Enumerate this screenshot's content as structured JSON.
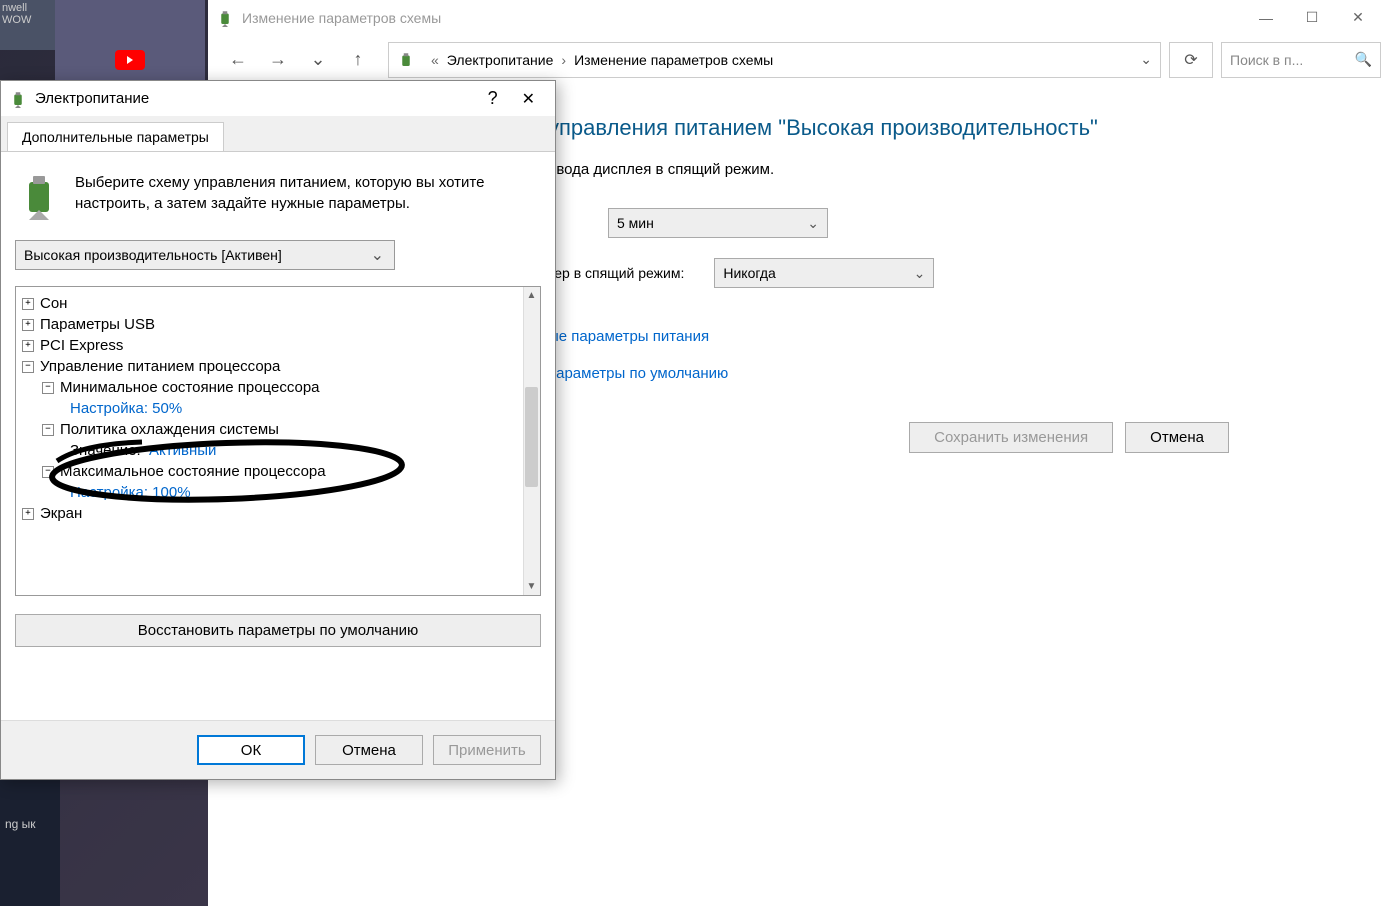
{
  "desktop": {
    "icon1": "nwell\nWOW",
    "yt_label": "YouTu",
    "bottom_label": "ng\nык"
  },
  "main_window": {
    "title": "Изменение параметров схемы",
    "breadcrumb": {
      "seg1_prefix": "«",
      "seg1": "Электропитание",
      "seg2": "Изменение параметров схемы"
    },
    "search_placeholder": "Поиск в п...",
    "heading": "управления питанием \"Высокая производительность\"",
    "subheading": "евода дисплея в спящий режим.",
    "row1_label": "",
    "row1_value": "5 мин",
    "row2_label": "тер в спящий режим:",
    "row2_value": "Никогда",
    "link1": "ые параметры питания",
    "link2": "параметры по умолчанию",
    "btn_save": "Сохранить изменения",
    "btn_cancel": "Отмена"
  },
  "dialog": {
    "title": "Электропитание",
    "tab": "Дополнительные параметры",
    "description": "Выберите схему управления питанием, которую вы хотите настроить, а затем задайте нужные параметры.",
    "plan_selected": "Высокая производительность [Активен]",
    "tree": {
      "item0": "Сон",
      "item1": "Параметры USB",
      "item2": "PCI Express",
      "item3": "Управление питанием процессора",
      "item3a": "Минимальное состояние процессора",
      "item3a_val": "Настройка: 50%",
      "item3b": "Политика охлаждения системы",
      "item3b_key": "Значение:",
      "item3b_val": "Активный",
      "item3c": "Максимальное состояние процессора",
      "item3c_val": "Настройка: 100%",
      "item4": "Экран"
    },
    "restore_btn": "Восстановить параметры по умолчанию",
    "btn_ok": "ОК",
    "btn_cancel": "Отмена",
    "btn_apply": "Применить"
  }
}
